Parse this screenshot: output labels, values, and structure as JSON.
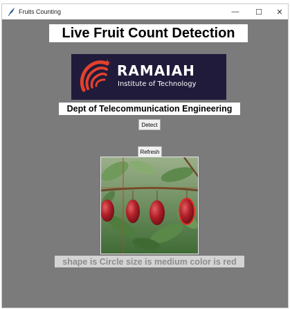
{
  "window": {
    "title": "Fruits Counting",
    "minimize_glyph": "—",
    "maximize_glyph": "☐",
    "close_glyph": "✕"
  },
  "app": {
    "heading": "Live Fruit Count Detection",
    "logo": {
      "name": "RAMAIAH",
      "subtitle": "Institute of Technology",
      "bg_color": "#201b3b",
      "accent_color": "#e2412d"
    },
    "department": "Dept of Telecommunication Engineering",
    "detect_label": "Detect",
    "refresh_label": "Refresh",
    "result_text": "shape is Circle size is medium color is red"
  },
  "colors": {
    "window_bg": "#7b7b7b",
    "label_bg": "#ffffff",
    "result_bg": "#d4d4d4",
    "result_text": "#8c8c8c"
  },
  "icons": {
    "app_icon": "feather-icon",
    "photo": "fruit-tree-photo"
  }
}
